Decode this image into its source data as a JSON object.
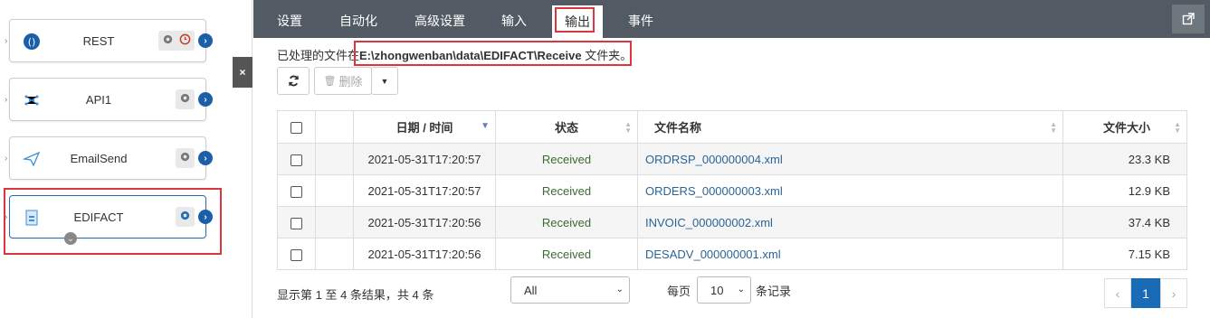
{
  "flow": {
    "nodes": [
      {
        "label": "REST",
        "icon": "rest-port-icon",
        "tools": [
          "gear-icon",
          "clock-icon"
        ]
      },
      {
        "label": "API1",
        "icon": "api-port-icon",
        "tools": [
          "gear-icon"
        ]
      },
      {
        "label": "EmailSend",
        "icon": "email-send-icon",
        "tools": [
          "gear-icon"
        ]
      },
      {
        "label": "EDIFACT",
        "icon": "edifact-port-icon",
        "tools": [
          "gear-icon"
        ],
        "selected": true
      }
    ],
    "collapse_label": "×"
  },
  "tabs": [
    {
      "label": "设置"
    },
    {
      "label": "自动化"
    },
    {
      "label": "高级设置"
    },
    {
      "label": "输入"
    },
    {
      "label": "输出",
      "active": true
    },
    {
      "label": "事件"
    }
  ],
  "path_info": {
    "prefix": "已处理的文件在",
    "path": "E:\\zhongwenban\\data\\EDIFACT\\Receive",
    "suffix": " 文件夹。"
  },
  "toolbar": {
    "delete_label": "删除"
  },
  "table": {
    "headers": [
      "日期 / 时间",
      "状态",
      "文件名称",
      "文件大小"
    ],
    "rows": [
      {
        "datetime": "2021-05-31T17:20:57",
        "status": "Received",
        "filename": "ORDRSP_000000004.xml",
        "size": "23.3 KB"
      },
      {
        "datetime": "2021-05-31T17:20:57",
        "status": "Received",
        "filename": "ORDERS_000000003.xml",
        "size": "12.9 KB"
      },
      {
        "datetime": "2021-05-31T17:20:56",
        "status": "Received",
        "filename": "INVOIC_000000002.xml",
        "size": "37.4 KB"
      },
      {
        "datetime": "2021-05-31T17:20:56",
        "status": "Received",
        "filename": "DESADV_000000001.xml",
        "size": "7.15 KB"
      }
    ]
  },
  "footer": {
    "info": "显示第 1 至 4 条结果，共 4 条",
    "filter_value": "All",
    "per_page_prefix": "每页",
    "per_page_value": "10",
    "per_page_suffix": "条记录",
    "current_page": "1",
    "prev": "‹",
    "next": "›"
  },
  "colors": {
    "tabbar_bg": "#525b63",
    "accent_blue": "#1a6bb5",
    "highlight_red": "#d9363e",
    "status_green": "#3a6b2f"
  }
}
